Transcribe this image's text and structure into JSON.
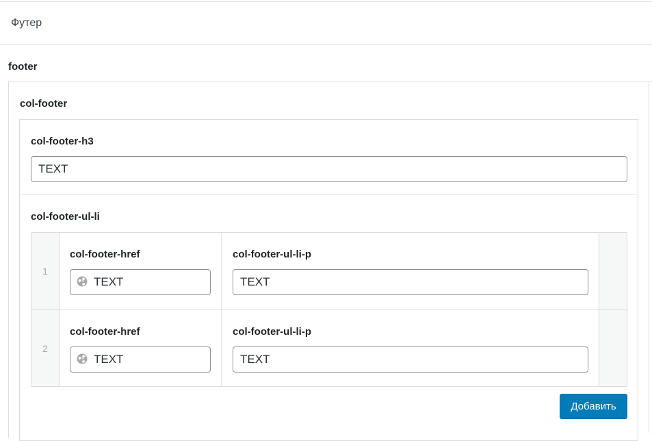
{
  "section": {
    "title": "Футер"
  },
  "footer": {
    "label": "footer",
    "col_footer": {
      "label": "col-footer",
      "h3": {
        "label": "col-footer-h3",
        "value": "TEXT"
      },
      "ul_li": {
        "label": "col-footer-ul-li",
        "rows": [
          {
            "order": "1",
            "href_label": "col-footer-href",
            "href_value": "TEXT",
            "p_label": "col-footer-ul-li-p",
            "p_value": "TEXT"
          },
          {
            "order": "2",
            "href_label": "col-footer-href",
            "href_value": "TEXT",
            "p_label": "col-footer-ul-li-p",
            "p_value": "TEXT"
          }
        ],
        "add_button_label": "Добавить"
      }
    }
  },
  "icons": {
    "url_field": "globe-icon"
  },
  "colors": {
    "primary_button": "#007cba",
    "border": "#dcdcde",
    "input_border": "#8c8f94",
    "row_gutter": "#f6f7f7"
  }
}
